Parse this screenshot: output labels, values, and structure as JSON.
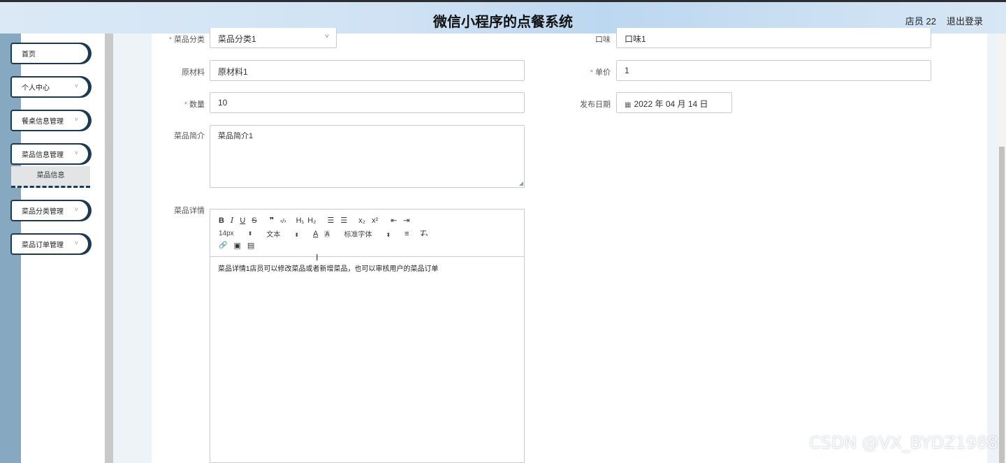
{
  "header": {
    "title": "微信小程序的点餐系统",
    "user": "店员 22",
    "logout": "退出登录"
  },
  "sidebar": {
    "items": [
      {
        "label": "首页"
      },
      {
        "label": "个人中心"
      },
      {
        "label": "餐桌信息管理"
      },
      {
        "label": "菜品信息管理"
      },
      {
        "label": "菜品分类管理"
      },
      {
        "label": "菜品订单管理"
      }
    ],
    "submenu": "菜品信息",
    "chevron": "˅"
  },
  "form": {
    "category": {
      "label": "菜品分类",
      "value": "菜品分类1"
    },
    "taste": {
      "label": "口味",
      "value": "口味1"
    },
    "material": {
      "label": "原材料",
      "value": "原材料1"
    },
    "price": {
      "label": "单价",
      "value": "1"
    },
    "quantity": {
      "label": "数量",
      "value": "10"
    },
    "publish_date": {
      "label": "发布日期",
      "value": "2022 年 04 月 14 日"
    },
    "intro": {
      "label": "菜品简介",
      "value": "菜品简介1"
    },
    "detail": {
      "label": "菜品详情",
      "value": "菜品详情1店员可以修改菜品或者新增菜品，也可以审核用户的菜品订单"
    }
  },
  "editor_toolbar": {
    "font_size": "14px",
    "text_type": "文本",
    "font_family": "标准字体",
    "bold": "B",
    "italic": "I",
    "underline": "U",
    "strike": "S",
    "quote": "❞",
    "code": "‹/›",
    "h1": "H₁",
    "h2": "H₂",
    "ol": "☰",
    "ul": "☰",
    "sub": "x₂",
    "sup": "x²",
    "indent_left": "⇤",
    "indent_right": "⇥",
    "color": "A",
    "bg": "A",
    "align": "≡",
    "clear": "T̶ₓ",
    "link": "🔗",
    "image": "▣",
    "video": "▤"
  },
  "watermark": "CSDN @VX_BYDZ1988",
  "icons": {
    "calendar": "calendar-icon",
    "select_arrow": "chevron-down-icon"
  }
}
